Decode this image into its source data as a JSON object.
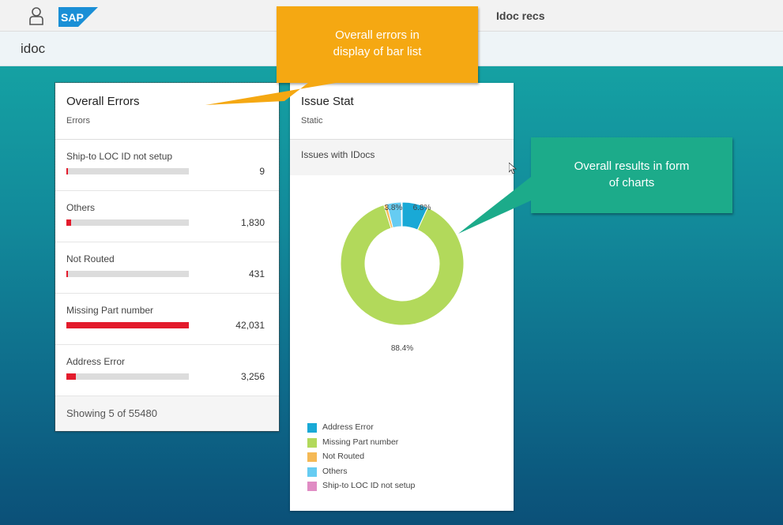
{
  "header": {
    "app_title": "Idoc recs",
    "logo_text": "SAP"
  },
  "page": {
    "title": "idoc"
  },
  "errors_card": {
    "title": "Overall Errors",
    "subtitle": "Errors",
    "items": [
      {
        "label": "Ship-to LOC ID not setup",
        "value": "9",
        "fraction": 0.01
      },
      {
        "label": "Others",
        "value": "1,830",
        "fraction": 0.04
      },
      {
        "label": "Not Routed",
        "value": "431",
        "fraction": 0.01
      },
      {
        "label": "Missing Part number",
        "value": "42,031",
        "fraction": 1.0
      },
      {
        "label": "Address Error",
        "value": "3,256",
        "fraction": 0.08
      }
    ],
    "footer": "Showing 5 of 55480",
    "bar_color": "#e31b2c"
  },
  "stat_card": {
    "title": "Issue Stat",
    "subtitle": "Static",
    "section_title": "Issues with IDocs"
  },
  "chart_data": {
    "type": "pie",
    "donut": true,
    "categories": [
      "Address Error",
      "Missing Part number",
      "Not Routed",
      "Others",
      "Ship-to LOC ID not setup"
    ],
    "values": [
      6.8,
      88.4,
      0.8,
      3.8,
      0.2
    ],
    "unit": "%",
    "data_labels": [
      "6.8%",
      "88.4%",
      "",
      "3.8%",
      ""
    ],
    "colors": [
      "#19a9d6",
      "#b2d95b",
      "#f5b955",
      "#66ccf2",
      "#e08cc4"
    ],
    "legend_position": "bottom"
  },
  "callouts": {
    "orange": {
      "text_lines": [
        "Overall errors in",
        "display of bar list"
      ],
      "color": "#f5a812"
    },
    "green": {
      "text_lines": [
        "Overall results in form",
        "of charts"
      ],
      "color": "#1cab8a"
    }
  },
  "icons": {
    "user": "user-icon",
    "logo": "sap-logo",
    "cursor": "mouse-cursor-icon"
  }
}
